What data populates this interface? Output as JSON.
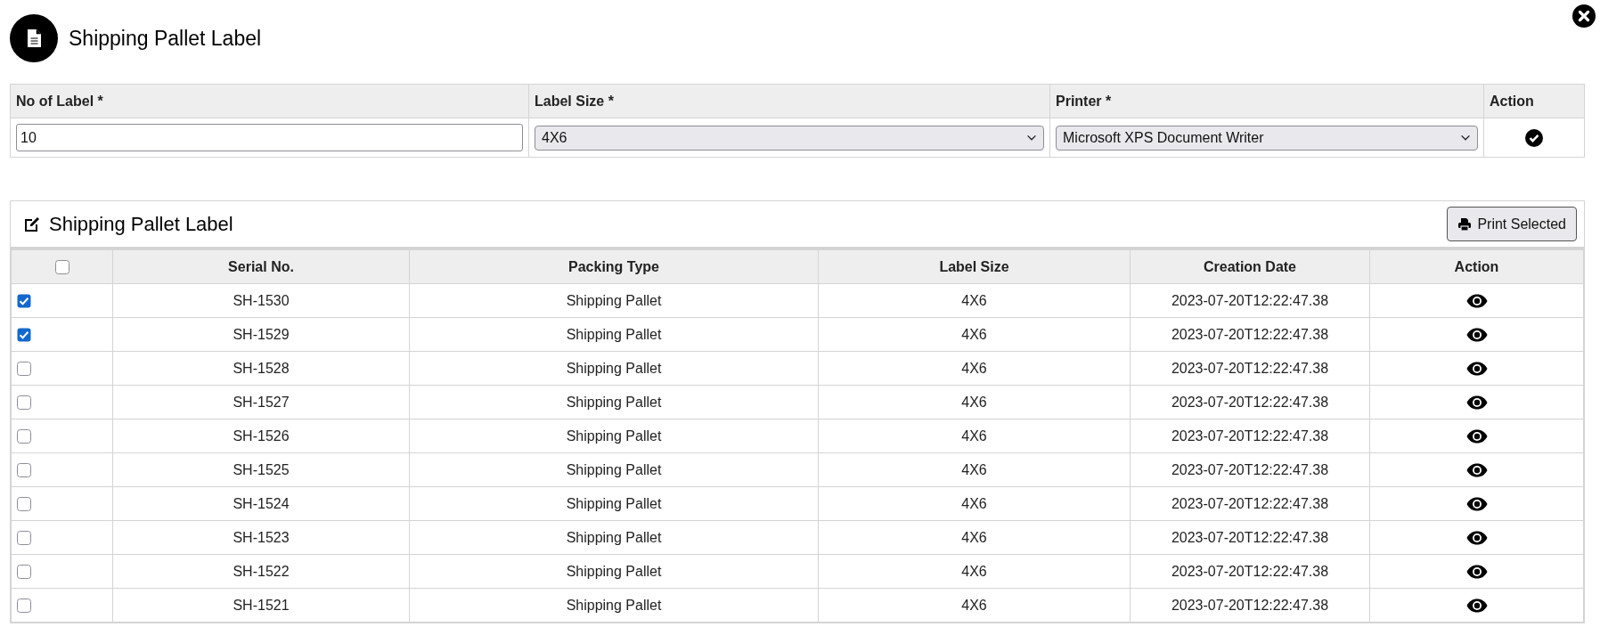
{
  "header": {
    "title": "Shipping Pallet Label"
  },
  "form": {
    "columns": [
      "No of Label *",
      "Label Size *",
      "Printer *",
      "Action"
    ],
    "no_of_label": {
      "value": "10"
    },
    "label_size": {
      "value": "4X6"
    },
    "printer": {
      "value": "Microsoft XPS Document Writer"
    }
  },
  "labels_panel": {
    "title": "Shipping Pallet Label",
    "print_button": "Print Selected",
    "select_all": {
      "checked": false
    },
    "columns": [
      "Serial No.",
      "Packing Type",
      "Label Size",
      "Creation Date",
      "Action"
    ],
    "rows": [
      {
        "checked": true,
        "serial": "SH-1530",
        "packing_type": "Shipping Pallet",
        "label_size": "4X6",
        "creation_date": "2023-07-20T12:22:47.38"
      },
      {
        "checked": true,
        "serial": "SH-1529",
        "packing_type": "Shipping Pallet",
        "label_size": "4X6",
        "creation_date": "2023-07-20T12:22:47.38"
      },
      {
        "checked": false,
        "serial": "SH-1528",
        "packing_type": "Shipping Pallet",
        "label_size": "4X6",
        "creation_date": "2023-07-20T12:22:47.38"
      },
      {
        "checked": false,
        "serial": "SH-1527",
        "packing_type": "Shipping Pallet",
        "label_size": "4X6",
        "creation_date": "2023-07-20T12:22:47.38"
      },
      {
        "checked": false,
        "serial": "SH-1526",
        "packing_type": "Shipping Pallet",
        "label_size": "4X6",
        "creation_date": "2023-07-20T12:22:47.38"
      },
      {
        "checked": false,
        "serial": "SH-1525",
        "packing_type": "Shipping Pallet",
        "label_size": "4X6",
        "creation_date": "2023-07-20T12:22:47.38"
      },
      {
        "checked": false,
        "serial": "SH-1524",
        "packing_type": "Shipping Pallet",
        "label_size": "4X6",
        "creation_date": "2023-07-20T12:22:47.38"
      },
      {
        "checked": false,
        "serial": "SH-1523",
        "packing_type": "Shipping Pallet",
        "label_size": "4X6",
        "creation_date": "2023-07-20T12:22:47.38"
      },
      {
        "checked": false,
        "serial": "SH-1522",
        "packing_type": "Shipping Pallet",
        "label_size": "4X6",
        "creation_date": "2023-07-20T12:22:47.38"
      },
      {
        "checked": false,
        "serial": "SH-1521",
        "packing_type": "Shipping Pallet",
        "label_size": "4X6",
        "creation_date": "2023-07-20T12:22:47.38"
      }
    ]
  }
}
